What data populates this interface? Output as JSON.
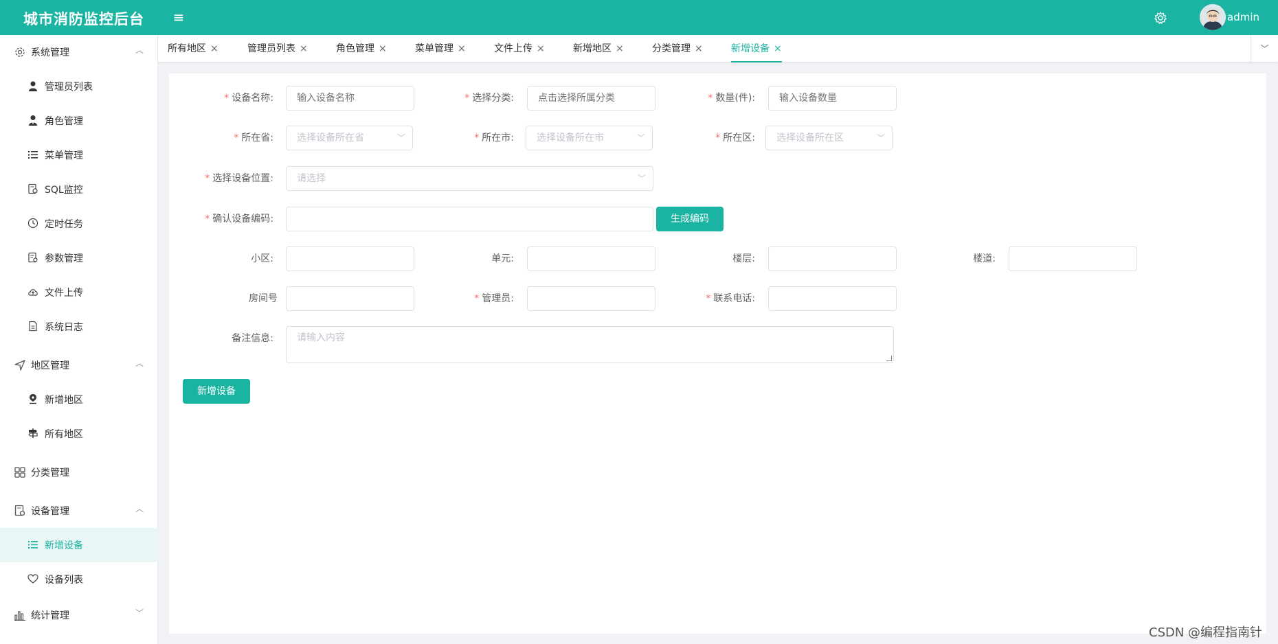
{
  "header": {
    "title": "城市消防监控后台",
    "menu_toggle": "≡",
    "username": "admin"
  },
  "sidebar": {
    "system": {
      "label": "系统管理",
      "items": [
        "管理员列表",
        "角色管理",
        "菜单管理",
        "SQL监控",
        "定时任务",
        "参数管理",
        "文件上传",
        "系统日志"
      ]
    },
    "region": {
      "label": "地区管理",
      "items": [
        "新增地区",
        "所有地区"
      ]
    },
    "category": {
      "label": "分类管理"
    },
    "device": {
      "label": "设备管理",
      "items": [
        "新增设备",
        "设备列表"
      ],
      "active_item": "新增设备"
    },
    "stats": {
      "label": "统计管理"
    }
  },
  "tabs": {
    "items": [
      "所有地区",
      "管理员列表",
      "角色管理",
      "菜单管理",
      "文件上传",
      "新增地区",
      "分类管理",
      "新增设备"
    ],
    "active": "新增设备",
    "close_glyph": "×"
  },
  "form": {
    "device_name": {
      "label": "设备名称:",
      "placeholder": "输入设备名称"
    },
    "category": {
      "label": "选择分类:",
      "placeholder": "点击选择所属分类"
    },
    "quantity": {
      "label": "数量(件):",
      "placeholder": "输入设备数量"
    },
    "province": {
      "label": "所在省:",
      "placeholder": "选择设备所在省"
    },
    "city": {
      "label": "所在市:",
      "placeholder": "选择设备所在市"
    },
    "district": {
      "label": "所在区:",
      "placeholder": "选择设备所在区"
    },
    "location": {
      "label": "选择设备位置:",
      "placeholder": "请选择"
    },
    "code": {
      "label": "确认设备编码:",
      "value": "",
      "button": "生成编码"
    },
    "community": {
      "label": "小区:"
    },
    "unit": {
      "label": "单元:"
    },
    "floor": {
      "label": "楼层:"
    },
    "building": {
      "label": "楼道:"
    },
    "room": {
      "label": "房间号"
    },
    "manager": {
      "label": "管理员:"
    },
    "phone": {
      "label": "联系电话:"
    },
    "remark": {
      "label": "备注信息:",
      "placeholder": "请输入内容"
    },
    "submit": "新增设备"
  },
  "watermark": "CSDN @编程指南针",
  "colors": {
    "primary": "#1bb3a2",
    "required": "#f56c6c"
  }
}
